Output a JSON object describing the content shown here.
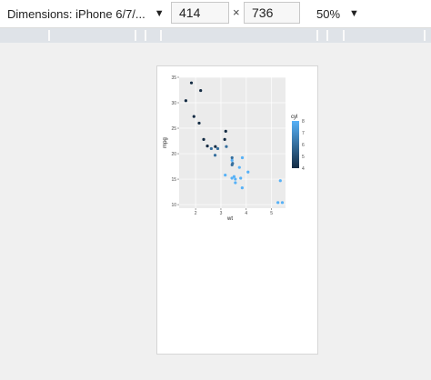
{
  "toolbar": {
    "dimensions_label": "Dimensions: iPhone 6/7/...",
    "width_value": "414",
    "times_symbol": "×",
    "height_value": "736",
    "zoom_label": "50%"
  },
  "chart_data": {
    "type": "scatter",
    "xlabel": "wt",
    "ylabel": "mpg",
    "xlim": [
      1.35,
      5.55
    ],
    "ylim": [
      9.3,
      35.0
    ],
    "x_ticks": [
      2,
      3,
      4,
      5
    ],
    "y_ticks": [
      10,
      15,
      20,
      25,
      30,
      35
    ],
    "legend": {
      "title": "cyl",
      "ticks": [
        4,
        5,
        6,
        7,
        8
      ],
      "position": "right"
    },
    "color_scale": {
      "low": "#132b43",
      "high": "#56b1f7",
      "min": 4,
      "max": 8
    },
    "points": [
      {
        "x": 1.615,
        "y": 30.4,
        "c": 4
      },
      {
        "x": 1.835,
        "y": 33.9,
        "c": 4
      },
      {
        "x": 1.935,
        "y": 27.3,
        "c": 4
      },
      {
        "x": 2.14,
        "y": 26.0,
        "c": 4
      },
      {
        "x": 2.2,
        "y": 32.4,
        "c": 4
      },
      {
        "x": 2.32,
        "y": 22.8,
        "c": 4
      },
      {
        "x": 2.465,
        "y": 21.5,
        "c": 4
      },
      {
        "x": 2.62,
        "y": 21.0,
        "c": 6
      },
      {
        "x": 2.77,
        "y": 19.7,
        "c": 6
      },
      {
        "x": 2.78,
        "y": 21.4,
        "c": 4
      },
      {
        "x": 2.875,
        "y": 21.0,
        "c": 6
      },
      {
        "x": 3.15,
        "y": 22.8,
        "c": 4
      },
      {
        "x": 3.19,
        "y": 24.4,
        "c": 4
      },
      {
        "x": 3.215,
        "y": 21.4,
        "c": 6
      },
      {
        "x": 3.17,
        "y": 15.8,
        "c": 8
      },
      {
        "x": 3.435,
        "y": 15.2,
        "c": 8
      },
      {
        "x": 3.44,
        "y": 18.7,
        "c": 8
      },
      {
        "x": 3.44,
        "y": 17.8,
        "c": 6
      },
      {
        "x": 3.44,
        "y": 19.2,
        "c": 6
      },
      {
        "x": 3.46,
        "y": 18.1,
        "c": 6
      },
      {
        "x": 3.52,
        "y": 15.5,
        "c": 8
      },
      {
        "x": 3.57,
        "y": 14.3,
        "c": 8
      },
      {
        "x": 3.57,
        "y": 15.0,
        "c": 8
      },
      {
        "x": 3.73,
        "y": 17.3,
        "c": 8
      },
      {
        "x": 3.78,
        "y": 15.2,
        "c": 8
      },
      {
        "x": 3.84,
        "y": 13.3,
        "c": 8
      },
      {
        "x": 3.845,
        "y": 19.2,
        "c": 8
      },
      {
        "x": 4.07,
        "y": 16.4,
        "c": 8
      },
      {
        "x": 5.25,
        "y": 10.4,
        "c": 8
      },
      {
        "x": 5.345,
        "y": 14.7,
        "c": 8
      },
      {
        "x": 5.424,
        "y": 10.4,
        "c": 8
      }
    ]
  }
}
